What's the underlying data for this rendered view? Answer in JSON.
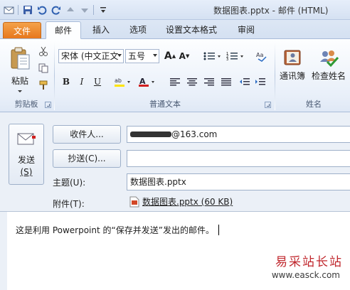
{
  "window": {
    "title": "数据图表.pptx - 邮件 (HTML)"
  },
  "tabs": [
    {
      "label": "文件"
    },
    {
      "label": "邮件"
    },
    {
      "label": "插入"
    },
    {
      "label": "选项"
    },
    {
      "label": "设置文本格式"
    },
    {
      "label": "审阅"
    }
  ],
  "ribbon": {
    "clipboard": {
      "paste": "粘贴",
      "group": "剪贴板"
    },
    "text": {
      "font": "宋体 (中文正文",
      "size": "五号",
      "group": "普通文本"
    },
    "names": {
      "address_book": "通讯簿",
      "check_names": "检查姓名",
      "group": "姓名"
    }
  },
  "compose": {
    "send": "发送",
    "send_key": "(S)",
    "to_button": "收件人...",
    "to_value": "@163.com",
    "cc_button": "抄送(C)...",
    "cc_value": "",
    "subject_label": "主题(U):",
    "subject_value": "数据图表.pptx",
    "attach_label": "附件(T):",
    "attach_value": "数据图表.pptx (60 KB)"
  },
  "body": {
    "text": "这是利用 Powerpoint 的“保存并发送”发出的邮件。"
  },
  "watermark": {
    "line1": "易采站长站",
    "line2": "www.easck.com"
  }
}
